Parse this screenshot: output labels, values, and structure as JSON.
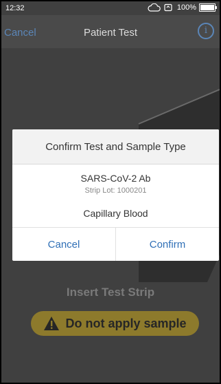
{
  "status_bar": {
    "time": "12:32",
    "battery_percent": "100%",
    "icons": [
      "cloud-icon",
      "sync-icon",
      "battery-icon"
    ]
  },
  "nav": {
    "cancel_label": "Cancel",
    "title": "Patient Test",
    "info_icon_glyph": "i"
  },
  "screen": {
    "insert_label": "Insert Test Strip",
    "warning_label": "Do not apply sample",
    "warning_icon": "warning-triangle-icon"
  },
  "dialog": {
    "title": "Confirm Test and Sample Type",
    "test_name": "SARS-CoV-2 Ab",
    "strip_lot": "Strip Lot: 1000201",
    "sample_type": "Capillary Blood",
    "cancel_label": "Cancel",
    "confirm_label": "Confirm"
  },
  "colors": {
    "accent_blue": "#2f6fb6",
    "nav_link": "#5b86b8",
    "warning_bg": "#8d7a2c"
  }
}
